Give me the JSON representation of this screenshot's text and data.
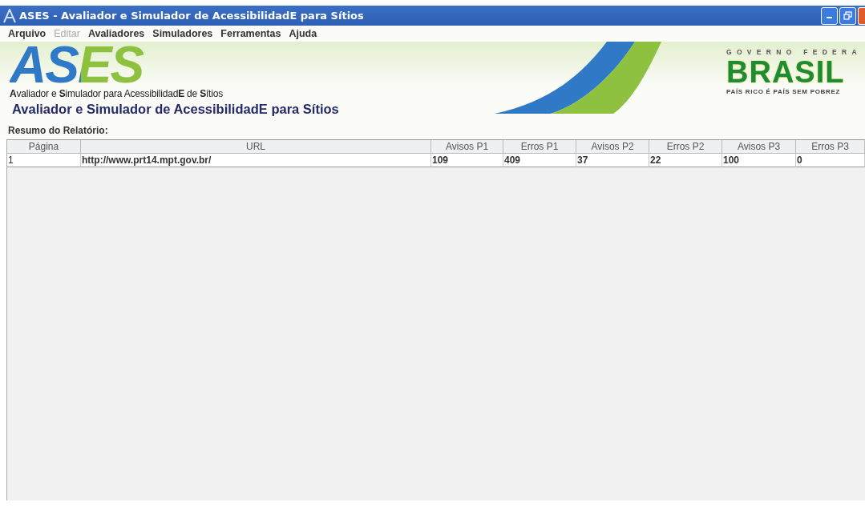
{
  "window": {
    "title": "ASES - Avaliador e Simulador de AcessibilidadE para Sítios"
  },
  "menu": [
    {
      "label": "Arquivo",
      "disabled": false
    },
    {
      "label": "Editar",
      "disabled": true
    },
    {
      "label": "Avaliadores",
      "disabled": false
    },
    {
      "label": "Simuladores",
      "disabled": false
    },
    {
      "label": "Ferramentas",
      "disabled": false
    },
    {
      "label": "Ajuda",
      "disabled": false
    }
  ],
  "banner": {
    "logo": "ASES",
    "tagline": "**A**valiador e **S**imulador para Acessibilidad**E** de **S**ítios",
    "heading": "Avaliador e Simulador de AcessibilidadE para Sítios",
    "gov_top": "GOVERNO FEDERA",
    "gov_name": "BRASIL",
    "gov_motto": "PAÍS RICO É PAÍS SEM POBREZ"
  },
  "report_label": "Resumo do Relatório:",
  "table": {
    "columns": [
      "Página",
      "URL",
      "Avisos P1",
      "Erros P1",
      "Avisos P2",
      "Erros P2",
      "Avisos P3",
      "Erros P3"
    ],
    "rows": [
      [
        "1",
        "http://www.prt14.mpt.gov.br/",
        "109",
        "409",
        "37",
        "22",
        "100",
        "0"
      ]
    ]
  }
}
